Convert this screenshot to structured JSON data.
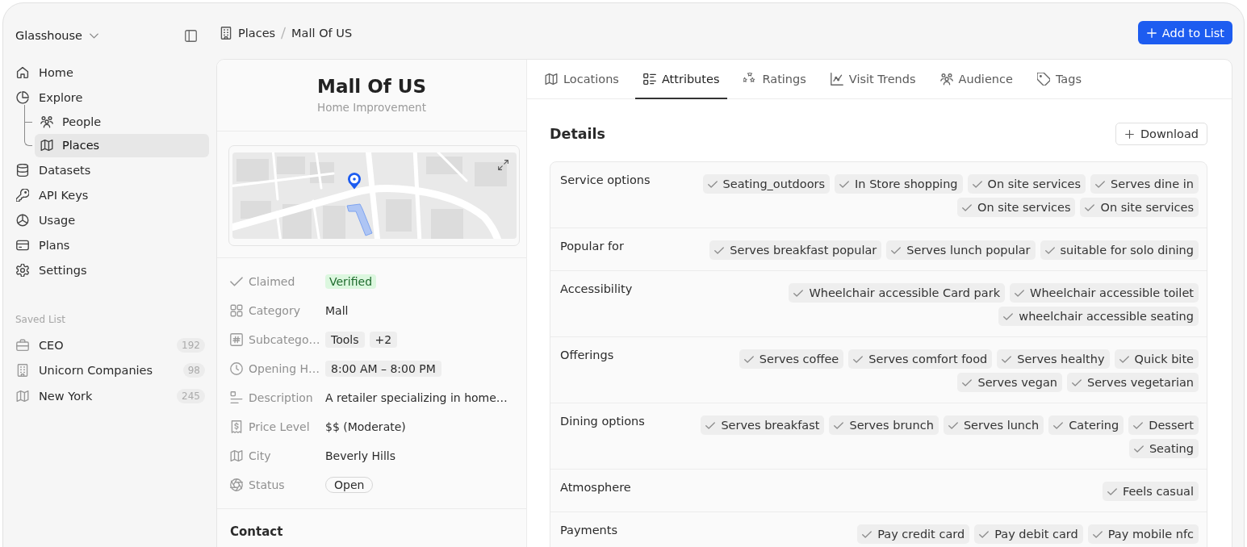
{
  "sidebar": {
    "workspace": "Glasshouse",
    "nav": [
      {
        "label": "Home",
        "selected": false
      },
      {
        "label": "Explore",
        "selected": false,
        "children": [
          {
            "label": "People",
            "selected": false
          },
          {
            "label": "Places",
            "selected": true
          }
        ]
      },
      {
        "label": "Datasets",
        "selected": false
      },
      {
        "label": "API Keys",
        "selected": false
      },
      {
        "label": "Usage",
        "selected": false
      },
      {
        "label": "Plans",
        "selected": false
      },
      {
        "label": "Settings",
        "selected": false
      }
    ],
    "saved_list": {
      "title": "Saved List",
      "items": [
        {
          "label": "CEO",
          "count": "192",
          "selected": false
        },
        {
          "label": "Unicorn Companies",
          "count": "98",
          "selected": false
        },
        {
          "label": "New York",
          "count": "245",
          "selected": false
        }
      ]
    }
  },
  "header": {
    "breadcrumb": [
      "Places",
      "Mall Of US"
    ],
    "add_button": "Add to List"
  },
  "place": {
    "name": "Mall Of US",
    "category": "Home Improvement",
    "fields": [
      {
        "label": "Claimed",
        "kind": "badge",
        "value": "Verified"
      },
      {
        "label": "Category",
        "kind": "text",
        "value": "Mall"
      },
      {
        "label": "Subcatego…",
        "kind": "tags",
        "values": [
          "Tools",
          "+2"
        ]
      },
      {
        "label": "Opening H…",
        "kind": "tags",
        "values": [
          "8:00 AM – 8:00 PM"
        ]
      },
      {
        "label": "Description",
        "kind": "text",
        "value": "A retailer specializing in home…"
      },
      {
        "label": "Price Level",
        "kind": "text",
        "value": "$$ (Moderate)"
      },
      {
        "label": "City",
        "kind": "text",
        "value": "Beverly Hills"
      },
      {
        "label": "Status",
        "kind": "pill",
        "value": "Open"
      }
    ],
    "contact_title": "Contact"
  },
  "tabs": [
    {
      "label": "Locations",
      "selected": false
    },
    {
      "label": "Attributes",
      "selected": true
    },
    {
      "label": "Ratings",
      "selected": false
    },
    {
      "label": "Visit Trends",
      "selected": false
    },
    {
      "label": "Audience",
      "selected": false
    },
    {
      "label": "Tags",
      "selected": false
    }
  ],
  "details": {
    "title": "Details",
    "download_button": "Download",
    "groups": [
      {
        "label": "Service options",
        "items": [
          "Seating_outdoors",
          "In Store shopping",
          "On site services",
          "Serves dine in",
          "On site services",
          "On site services"
        ]
      },
      {
        "label": "Popular for",
        "items": [
          "Serves breakfast popular",
          "Serves lunch popular",
          "suitable for solo dining"
        ]
      },
      {
        "label": "Accessibility",
        "items": [
          "Wheelchair accessible Card park",
          "Wheelchair accessible toilet",
          "wheelchair accessible seating"
        ]
      },
      {
        "label": "Offerings",
        "items": [
          "Serves coffee",
          "Serves comfort food",
          "Serves healthy",
          "Quick bite",
          "Serves vegan",
          "Serves vegetarian"
        ]
      },
      {
        "label": "Dining options",
        "items": [
          "Serves breakfast",
          "Serves brunch",
          "Serves lunch",
          "Catering",
          "Dessert",
          "Seating"
        ]
      },
      {
        "label": "Atmosphere",
        "items": [
          "Feels casual"
        ]
      },
      {
        "label": "Payments",
        "items": [
          "Pay credit card",
          "Pay debit card",
          "Pay mobile nfc"
        ]
      }
    ]
  }
}
